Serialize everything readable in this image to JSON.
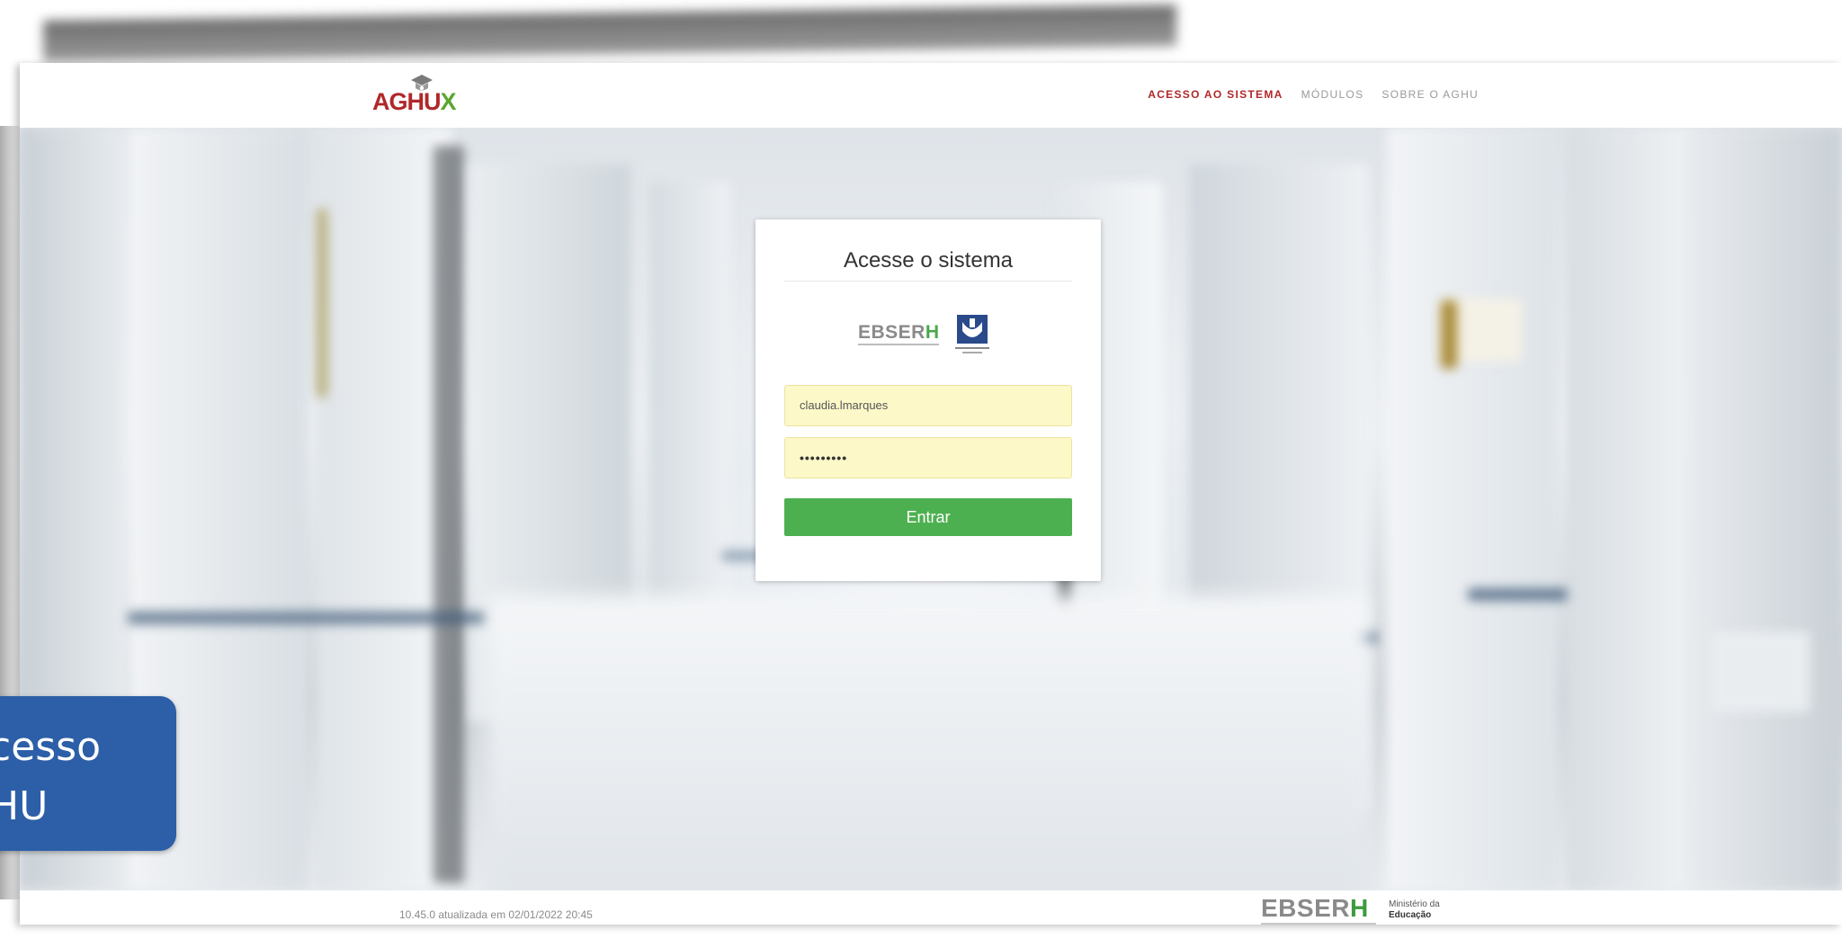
{
  "header": {
    "logo_text_main": "AGHU",
    "logo_text_accent": "X",
    "nav": [
      {
        "label": "ACESSO AO SISTEMA",
        "active": true
      },
      {
        "label": "MÓDULOS",
        "active": false
      },
      {
        "label": "SOBRE O AGHU",
        "active": false
      }
    ]
  },
  "login": {
    "title": "Acesse o sistema",
    "brand_text": "EBSER",
    "brand_text_accent": "H",
    "username_value": "claudia.lmarques",
    "password_value": "•••••••••",
    "submit_label": "Entrar"
  },
  "footer": {
    "version_text": "10.45.0 atualizada em 02/01/2022 20:45",
    "brand_text": "EBSER",
    "brand_text_accent": "H",
    "ministerio_line1": "Ministério da",
    "ministerio_line2": "Educação"
  },
  "overlay": {
    "line1": "cesso",
    "line2": "HU"
  },
  "colors": {
    "brand_red": "#b0282a",
    "brand_green": "#5aa630",
    "button_green": "#4db050",
    "autofill_yellow": "#fcf8c8",
    "overlay_blue": "#2d5fa8"
  }
}
